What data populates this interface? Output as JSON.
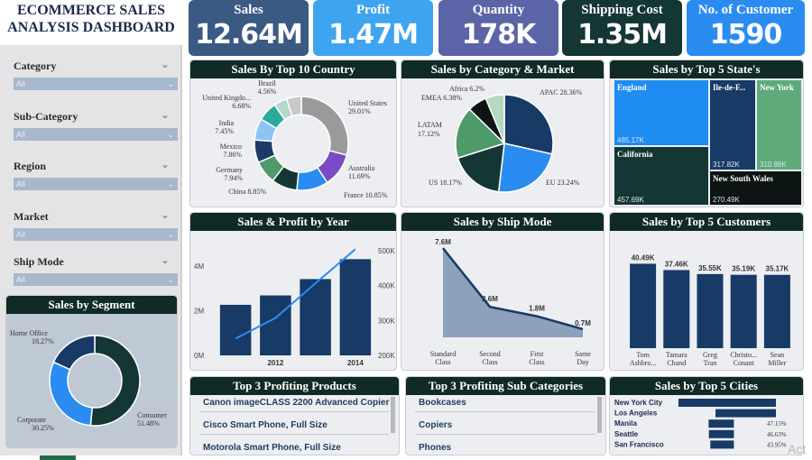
{
  "dashboard_title": "ECOMMERCE SALES ANALYSIS DASHBOARD",
  "filters": [
    {
      "label": "Category",
      "value": "All"
    },
    {
      "label": "Sub-Category",
      "value": "All"
    },
    {
      "label": "Region",
      "value": "All"
    },
    {
      "label": "Market",
      "value": "All"
    },
    {
      "label": "Ship Mode",
      "value": "All"
    }
  ],
  "kpis": [
    {
      "label": "Sales",
      "value": "12.64M",
      "color": "#3a5a84"
    },
    {
      "label": "Profit",
      "value": "1.47M",
      "color": "#3fa4f0"
    },
    {
      "label": "Quantity",
      "value": "178K",
      "color": "#5c64a8"
    },
    {
      "label": "Shipping Cost",
      "value": "1.35M",
      "color": "#143634"
    },
    {
      "label": "No. of Customer",
      "value": "1590",
      "color": "#2a8cf0"
    }
  ],
  "panels": {
    "country": "Sales By Top 10 Country",
    "category_market": "Sales by Category & Market",
    "states": "Sales by Top 5 State's",
    "year": "Sales & Profit by Year",
    "shipmode": "Sales by Ship Mode",
    "customers": "Sales by Top 5 Customers",
    "segment": "Sales by Segment",
    "products": "Top 3 Profiting Products",
    "subcats": "Top 3 Profiting Sub Categories",
    "cities": "Sales by Top 5 Cities"
  },
  "chart_data": [
    {
      "id": "country",
      "type": "pie",
      "title": "Sales By Top 10 Country",
      "slices": [
        {
          "label": "United States",
          "pct": "29.01%",
          "value": 29.01,
          "color": "#9a9a9a"
        },
        {
          "label": "Australia",
          "pct": "11.69%",
          "value": 11.69,
          "color": "#7a4bc4"
        },
        {
          "label": "France",
          "pct": "10.85%",
          "value": 10.85,
          "color": "#2a8cf0"
        },
        {
          "label": "China",
          "pct": "8.85%",
          "value": 8.85,
          "color": "#143634"
        },
        {
          "label": "Germany",
          "pct": "7.94%",
          "value": 7.94,
          "color": "#4e9a6a"
        },
        {
          "label": "Mexico",
          "pct": "7.86%",
          "value": 7.86,
          "color": "#1e3a68"
        },
        {
          "label": "India",
          "pct": "7.45%",
          "value": 7.45,
          "color": "#8ec4f4"
        },
        {
          "label": "United Kingdo...",
          "pct": "6.68%",
          "value": 6.68,
          "color": "#2aaa9a"
        },
        {
          "label": "Brazil",
          "pct": "4.56%",
          "value": 4.56,
          "color": "#b4d8c8"
        },
        {
          "label": "",
          "pct": "",
          "value": 5.11,
          "color": "#c8c8c8"
        }
      ]
    },
    {
      "id": "category_market",
      "type": "pie",
      "title": "Sales by Category & Market",
      "slices": [
        {
          "label": "APAC",
          "pct": "28.36%",
          "value": 28.36,
          "color": "#173a66"
        },
        {
          "label": "EU",
          "pct": "23.24%",
          "value": 23.24,
          "color": "#2a8cf0"
        },
        {
          "label": "US",
          "pct": "18.17%",
          "value": 18.17,
          "color": "#143634"
        },
        {
          "label": "LATAM",
          "pct": "17.12%",
          "value": 17.12,
          "color": "#4e9a6a"
        },
        {
          "label": "EMEA",
          "pct": "6.38%",
          "value": 6.38,
          "color": "#0c1414"
        },
        {
          "label": "Africa",
          "pct": "6.2%",
          "value": 6.2,
          "color": "#b4d8c0"
        }
      ]
    },
    {
      "id": "states",
      "type": "heatmap",
      "title": "Sales by Top 5 State's",
      "tiles": [
        {
          "label": "England",
          "value": "485.17K",
          "color": "#1e8cf0"
        },
        {
          "label": "Ile-de-F...",
          "value": "317.82K",
          "color": "#173a66"
        },
        {
          "label": "New York",
          "value": "310.88K",
          "color": "#5eaa7a"
        },
        {
          "label": "California",
          "value": "457.69K",
          "color": "#143634"
        },
        {
          "label": "New South Wales",
          "value": "270.49K",
          "color": "#0c1414"
        }
      ]
    },
    {
      "id": "year",
      "type": "bar",
      "title": "Sales & Profit by Year",
      "categories": [
        "2011",
        "2012",
        "2013",
        "2014"
      ],
      "x_ticks": [
        "2012",
        "2014"
      ],
      "series": [
        {
          "name": "",
          "values": [
            2.26,
            2.68,
            3.41,
            4.3
          ]
        },
        {
          "name": "",
          "values": [
            248,
            307,
            406,
            504
          ]
        }
      ],
      "y_left_ticks": [
        "0M",
        "2M",
        "4M"
      ],
      "y_right_ticks": [
        "200K",
        "300K",
        "400K",
        "500K"
      ],
      "ylim_left": [
        0,
        5
      ],
      "ylim_right": [
        200,
        520
      ]
    },
    {
      "id": "shipmode",
      "type": "area",
      "title": "Sales by Ship Mode",
      "categories": [
        "Standard Class",
        "Second Class",
        "First Class",
        "Same Day"
      ],
      "values": [
        7.6,
        2.6,
        1.8,
        0.7
      ],
      "labels": [
        "7.6M",
        "2.6M",
        "1.8M",
        "0.7M"
      ],
      "ylim": [
        0,
        8
      ]
    },
    {
      "id": "customers",
      "type": "bar",
      "title": "Sales by Top 5 Customers",
      "categories": [
        "Tom Ashbro...",
        "Tamara Chand",
        "Greg Tran",
        "Christo... Conant",
        "Sean Miller"
      ],
      "values": [
        40.49,
        37.46,
        35.55,
        35.19,
        35.17
      ],
      "labels": [
        "40.49K",
        "37.46K",
        "35.55K",
        "35.19K",
        "35.17K"
      ],
      "ylim": [
        0,
        45
      ]
    },
    {
      "id": "segment",
      "type": "pie",
      "title": "Sales by Segment",
      "slices": [
        {
          "label": "Consumer",
          "pct": "51.48%",
          "value": 51.48,
          "color": "#143634"
        },
        {
          "label": "Corporate",
          "pct": "30.25%",
          "value": 30.25,
          "color": "#2a8cf0"
        },
        {
          "label": "Home Office",
          "pct": "18.27%",
          "value": 18.27,
          "color": "#173a66"
        }
      ]
    },
    {
      "id": "cities",
      "type": "bar",
      "title": "Sales by Top 5 Cities",
      "categories": [
        "New York City",
        "Los Angeles",
        "Manila",
        "Seattle",
        "San Francisco"
      ],
      "values": [
        100,
        62,
        47.15,
        46.63,
        43.95
      ],
      "labels": [
        "",
        "",
        "47.15%",
        "46.63%",
        "43.95%"
      ]
    }
  ],
  "products": [
    "Canon imageCLASS 2200 Advanced Copier",
    "Cisco Smart Phone, Full Size",
    "Motorola Smart Phone, Full Size"
  ],
  "subcategories": [
    "Bookcases",
    "Copiers",
    "Phones"
  ],
  "corner_text": "Act"
}
